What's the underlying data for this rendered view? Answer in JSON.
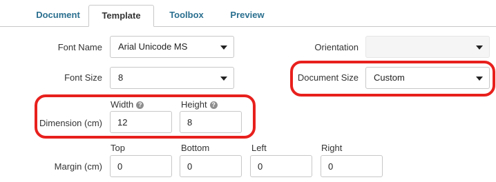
{
  "tabs": [
    {
      "label": "Document"
    },
    {
      "label": "Template"
    },
    {
      "label": "Toolbox"
    },
    {
      "label": "Preview"
    }
  ],
  "form": {
    "font_name": {
      "label": "Font Name",
      "value": "Arial Unicode MS"
    },
    "font_size": {
      "label": "Font Size",
      "value": "8"
    },
    "orientation": {
      "label": "Orientation",
      "value": ""
    },
    "document_size": {
      "label": "Document Size",
      "value": "Custom"
    },
    "dimension": {
      "label": "Dimension (cm)",
      "width": {
        "label": "Width",
        "value": "12"
      },
      "height": {
        "label": "Height",
        "value": "8"
      }
    },
    "margin": {
      "label": "Margin (cm)",
      "top": {
        "label": "Top",
        "value": "0"
      },
      "bottom": {
        "label": "Bottom",
        "value": "0"
      },
      "left": {
        "label": "Left",
        "value": "0"
      },
      "right": {
        "label": "Right",
        "value": "0"
      }
    }
  },
  "icons": {
    "help": "?"
  },
  "colors": {
    "tab_link": "#2a6f8f",
    "highlight": "#e8201d"
  }
}
